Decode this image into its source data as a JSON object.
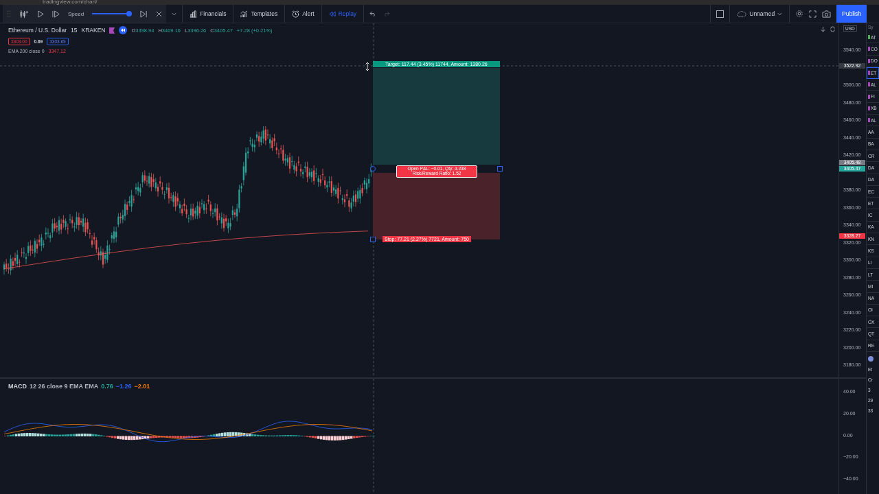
{
  "browser": {
    "url": "tradingview.com/chart/"
  },
  "toolbar": {
    "speed_label": "Speed",
    "speed": {
      "level": 0.93
    },
    "buttons": [
      {
        "kind": "financials",
        "label": "Financials",
        "active": false
      },
      {
        "kind": "templates",
        "label": "Templates",
        "active": false
      },
      {
        "kind": "alert",
        "label": "Alert",
        "active": false
      },
      {
        "kind": "replay",
        "label": "Replay",
        "active": true
      }
    ],
    "layout_name": "Unnamed",
    "publish": "Publish"
  },
  "legend": {
    "symbol": "Ethereum / U.S. Dollar",
    "interval": "15",
    "exchange": "KRAKEN",
    "ohlc": [
      {
        "key": "O",
        "value": "3398.94"
      },
      {
        "key": "H",
        "value": "3409.16"
      },
      {
        "key": "L",
        "value": "3396.26"
      },
      {
        "key": "C",
        "value": "3405.47"
      }
    ],
    "change": "+7.28 (+0.21%)",
    "bid": "3303.00",
    "spread": "0.69",
    "ask": "3303.69",
    "ema": {
      "label": "EMA 200 close 0",
      "value": "3347.12"
    }
  },
  "price_axis": {
    "currency": "USD",
    "ticks": [
      "3540.00",
      "3500.00",
      "3480.00",
      "3460.00",
      "3440.00",
      "3420.00",
      "3380.00",
      "3360.00",
      "3340.00",
      "3320.00",
      "3300.00",
      "3280.00",
      "3260.00",
      "3240.00",
      "3220.00",
      "3200.00",
      "3180.00"
    ],
    "labels": [
      {
        "kind": "crosshair",
        "text": "3522.92"
      },
      {
        "kind": "bid",
        "text": "3405.48"
      },
      {
        "kind": "last",
        "text": "3405.47"
      },
      {
        "kind": "stop",
        "text": "3328.27"
      }
    ]
  },
  "position": {
    "target": "Target: 117.44 (3.45%) 11744, Amount: 1380.26",
    "pnl": "Open P&L: −0.01, Qty: 3.238",
    "ratio": "Risk/Reward Ratio: 1.52",
    "stop": "Stop: 77.21 (2.27%) 7721, Amount: 750"
  },
  "macd": {
    "title": "MACD",
    "params": "12 26 close 9 EMA EMA",
    "values": [
      {
        "text": "0.76",
        "color": "#26a69a"
      },
      {
        "text": "−1.26",
        "color": "#2962ff"
      },
      {
        "text": "−2.01",
        "color": "#f57c00"
      }
    ],
    "ticks": [
      "40.00",
      "20.00",
      "0.00",
      "−20.00",
      "−40.00"
    ]
  },
  "watchlist": {
    "header": "Sy",
    "items": [
      {
        "text": "AT",
        "color": "#4caf50",
        "selected": false
      },
      {
        "text": "CO",
        "color": "#ab47bc",
        "selected": false
      },
      {
        "text": "DO",
        "color": "#ab47bc",
        "selected": false
      },
      {
        "text": "ET",
        "color": "#ab47bc",
        "selected": true
      },
      {
        "text": "AL",
        "color": "#ab47bc",
        "selected": false
      },
      {
        "text": "FI",
        "color": "#ab47bc",
        "selected": false
      },
      {
        "text": "XB",
        "color": "#ab47bc",
        "selected": false
      },
      {
        "text": "AL",
        "color": "#ab47bc",
        "selected": false
      },
      {
        "text": "AA",
        "selected": false
      },
      {
        "text": "BA",
        "selected": false
      },
      {
        "text": "CR",
        "selected": false
      },
      {
        "text": "DA",
        "selected": false
      },
      {
        "text": "DA",
        "selected": false
      },
      {
        "text": "EC",
        "selected": false
      },
      {
        "text": "ET",
        "selected": false
      },
      {
        "text": "IC",
        "selected": false
      },
      {
        "text": "KA",
        "selected": false
      },
      {
        "text": "KN",
        "selected": false
      },
      {
        "text": "KS",
        "selected": false
      },
      {
        "text": "LI",
        "selected": false
      },
      {
        "text": "LT",
        "selected": false
      },
      {
        "text": "MI",
        "selected": false
      },
      {
        "text": "NA",
        "selected": false
      },
      {
        "text": "OI",
        "selected": false
      },
      {
        "text": "OX",
        "selected": false
      },
      {
        "text": "QT",
        "selected": false
      },
      {
        "text": "RE",
        "selected": false
      }
    ],
    "details": [
      "Et",
      "Cr",
      "3",
      "29",
      "33"
    ]
  }
}
